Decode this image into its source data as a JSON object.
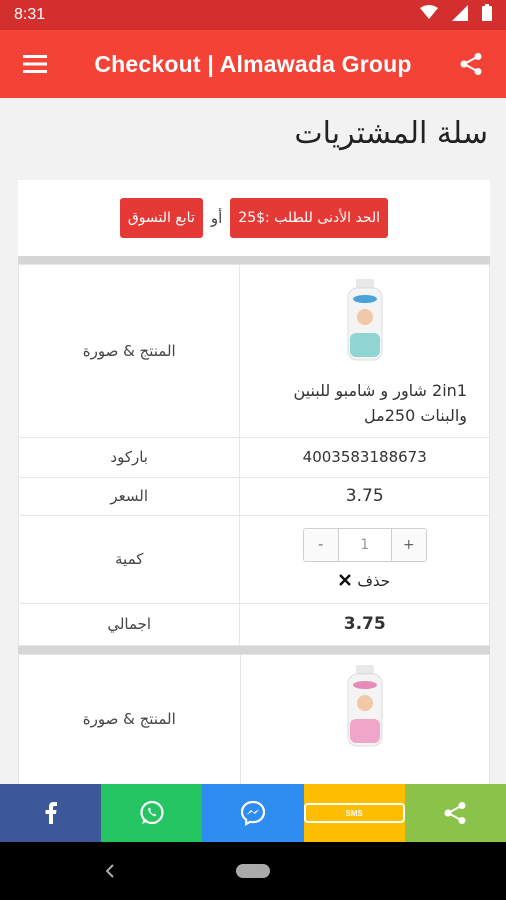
{
  "status_bar": {
    "time": "8:31"
  },
  "app_bar": {
    "title": "Checkout | Almawada Group"
  },
  "page": {
    "title": "سلة المشتريات"
  },
  "min_order": {
    "min_label": "الحد الأدنى للطلب :$25",
    "or_label": "أو",
    "continue_label": "تابع التسوق"
  },
  "labels": {
    "product_image": "المنتج & صورة",
    "barcode": "باركود",
    "price": "السعر",
    "quantity": "كمية",
    "total": "اجمالي"
  },
  "items": [
    {
      "name": "2in1 شاور و شامبو للبنين والبنات 250مل",
      "barcode": "4003583188673",
      "price": "3.75",
      "quantity": "1",
      "total": "3.75",
      "delete_label": "حذف",
      "bottle_color": "#4aa3d8"
    },
    {
      "bottle_color": "#e98bb8"
    }
  ],
  "stepper": {
    "minus": "-",
    "plus": "+"
  },
  "share_bar": [
    {
      "name": "facebook",
      "color": "#3b5998"
    },
    {
      "name": "whatsapp",
      "color": "#25c463"
    },
    {
      "name": "messenger",
      "color": "#2f8cf0"
    },
    {
      "name": "sms",
      "color": "#ffbd00",
      "text": "SMS"
    },
    {
      "name": "share",
      "color": "#8bc34a"
    }
  ],
  "colors": {
    "primary": "#f44336",
    "status": "#d32f2f",
    "accent_red": "#e53935"
  }
}
